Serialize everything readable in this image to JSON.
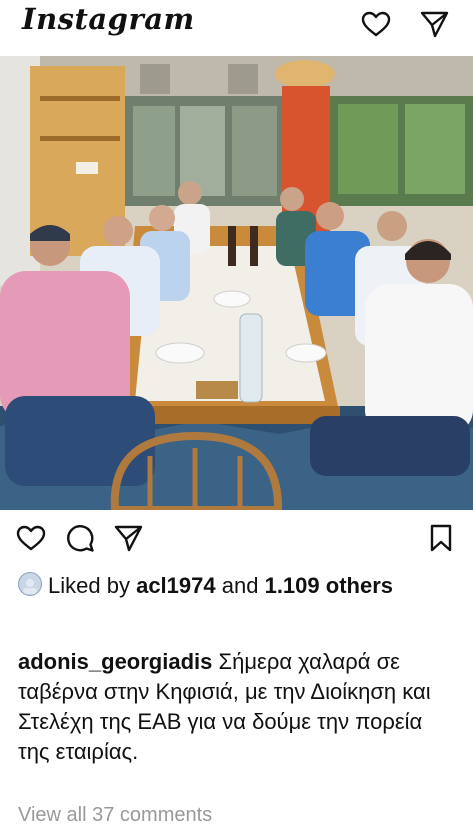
{
  "app": {
    "title": "Instagram"
  },
  "post": {
    "image_alt": "Group of men seated around a restaurant table",
    "likes": {
      "prefix": "Liked by",
      "user": "acl1974",
      "joiner": "and",
      "count": "1.109",
      "suffix": "others"
    },
    "caption": {
      "username": "adonis_georgiadis",
      "text": "Σήμερα χαλαρά σε ταβέρνα στην Κηφισιά, με την Διοίκηση και Στελέχη της ΕΑΒ για να δούμε την πορεία της εταιρίας."
    },
    "comments_cut": "View all 37 comments"
  },
  "icons": {
    "header": [
      "heart-icon",
      "direct-message-icon"
    ],
    "actions": [
      "like-heart-icon",
      "comment-icon",
      "share-icon",
      "bookmark-icon"
    ]
  },
  "colors": {
    "wall_orange": "#d8542e",
    "wood_table": "#c98a3c",
    "pink_shirt": "#e59ab8",
    "blue_shirt": "#3b7fd2"
  }
}
